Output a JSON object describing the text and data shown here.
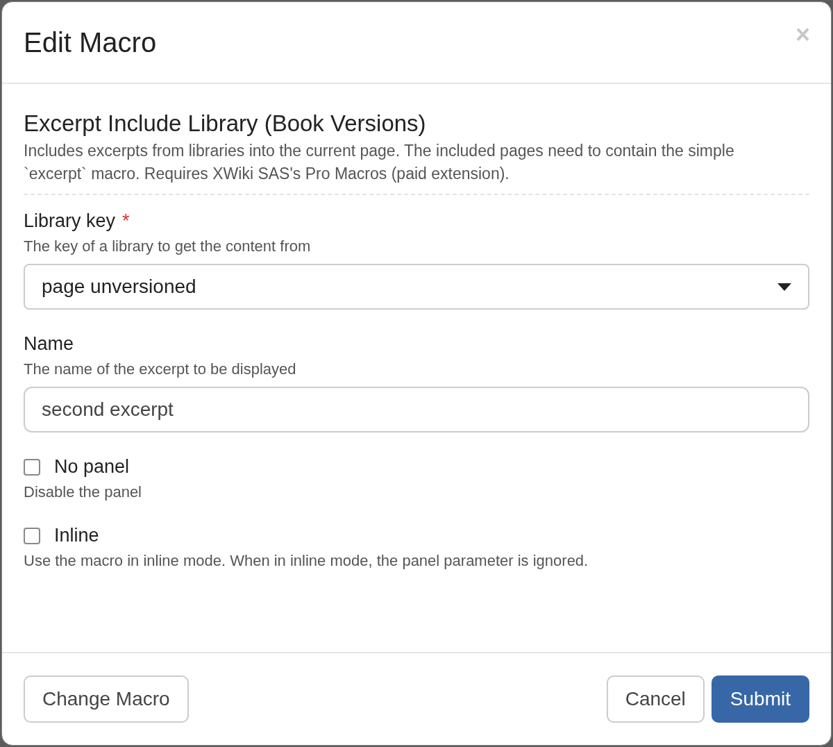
{
  "dialog": {
    "title": "Edit Macro",
    "close": "×"
  },
  "macro": {
    "name": "Excerpt Include Library (Book Versions)",
    "description": "Includes excerpts from libraries into the current page. The included pages need to contain the simple `excerpt` macro. Requires XWiki SAS's Pro Macros (paid extension)."
  },
  "parameters": [
    {
      "kind": "select",
      "label": "Library key",
      "required": true,
      "required_mark": "*",
      "hint": "The key of a library to get the content from",
      "value": "page unversioned"
    },
    {
      "kind": "text",
      "label": "Name",
      "required": false,
      "hint": "The name of the excerpt to be displayed",
      "value": "second excerpt"
    },
    {
      "kind": "checkbox",
      "label": "No panel",
      "checked": false,
      "hint": "Disable the panel"
    },
    {
      "kind": "checkbox",
      "label": "Inline",
      "checked": false,
      "hint": "Use the macro in inline mode. When in inline mode, the panel parameter is ignored."
    }
  ],
  "footer": {
    "change_button": "Change Macro",
    "buttons": [
      {
        "label": "Cancel",
        "primary": false
      },
      {
        "label": "Submit",
        "primary": true
      }
    ]
  }
}
